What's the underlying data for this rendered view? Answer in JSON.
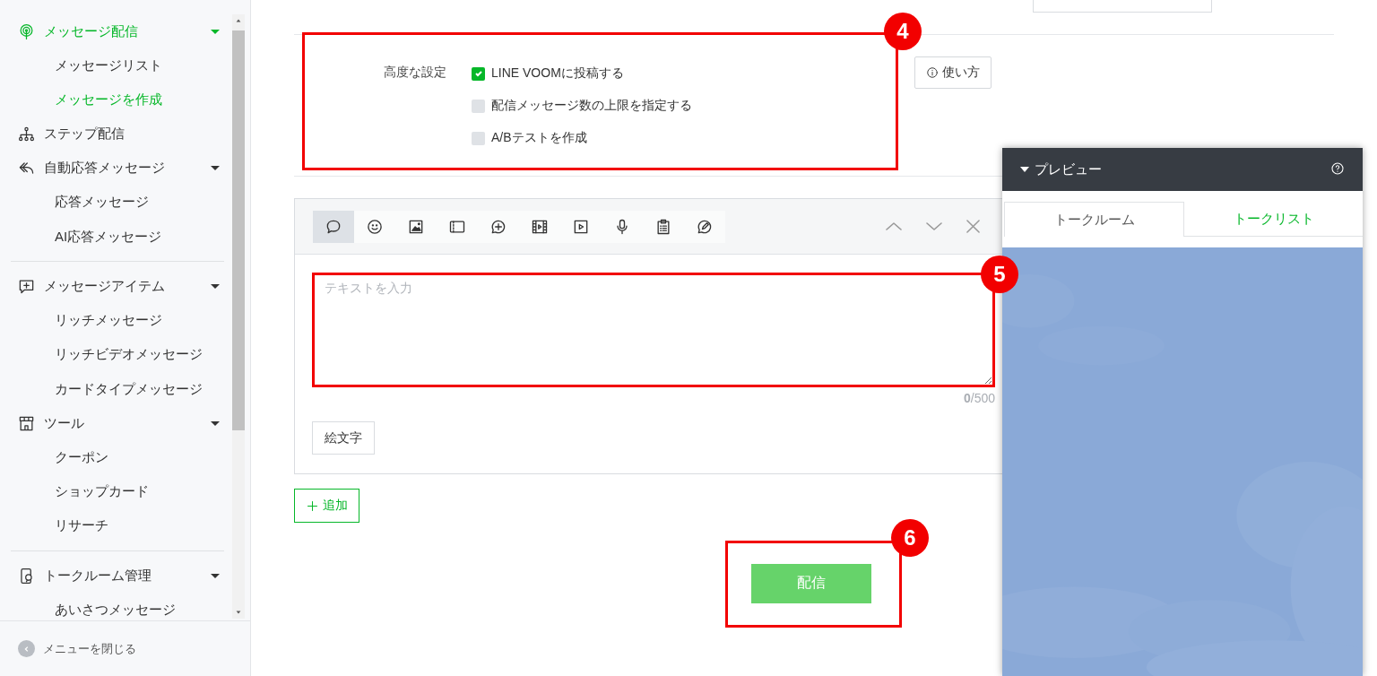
{
  "sidebar": {
    "sections": [
      {
        "items": [
          {
            "label": "メッセージ配信",
            "selected": true,
            "expanded": true,
            "children": [
              {
                "label": "メッセージリスト",
                "selected": false
              },
              {
                "label": "メッセージを作成",
                "selected": true
              }
            ]
          },
          {
            "label": "ステップ配信",
            "selected": false
          },
          {
            "label": "自動応答メッセージ",
            "selected": false,
            "expanded": true,
            "children": [
              {
                "label": "応答メッセージ",
                "selected": false
              },
              {
                "label": "AI応答メッセージ",
                "selected": false
              }
            ]
          }
        ]
      },
      {
        "items": [
          {
            "label": "メッセージアイテム",
            "selected": false,
            "expanded": true,
            "children": [
              {
                "label": "リッチメッセージ",
                "selected": false
              },
              {
                "label": "リッチビデオメッセージ",
                "selected": false
              },
              {
                "label": "カードタイプメッセージ",
                "selected": false
              }
            ]
          },
          {
            "label": "ツール",
            "selected": false,
            "expanded": true,
            "children": [
              {
                "label": "クーポン",
                "selected": false
              },
              {
                "label": "ショップカード",
                "selected": false
              },
              {
                "label": "リサーチ",
                "selected": false
              }
            ]
          }
        ]
      },
      {
        "items": [
          {
            "label": "トークルーム管理",
            "selected": false,
            "expanded": true,
            "children": [
              {
                "label": "あいさつメッセージ",
                "selected": false
              }
            ]
          }
        ]
      }
    ],
    "close_label": "メニューを閉じる"
  },
  "settings": {
    "label": "高度な設定",
    "annotation": "4",
    "options": [
      {
        "label": "LINE VOOMに投稿する",
        "checked": true
      },
      {
        "label": "配信メッセージ数の上限を指定する",
        "checked": false
      },
      {
        "label": "A/Bテストを作成",
        "checked": false
      }
    ],
    "help_button": "使い方"
  },
  "editor": {
    "tools": [
      {
        "selected": true
      },
      {
        "selected": false
      },
      {
        "selected": false
      },
      {
        "selected": false
      },
      {
        "selected": false
      },
      {
        "selected": false
      },
      {
        "selected": false
      },
      {
        "selected": false
      },
      {
        "selected": false
      },
      {
        "selected": false
      }
    ],
    "placeholder": "テキストを入力",
    "annotation": "5",
    "counter": "**0**/500",
    "emoji_button": "絵文字"
  },
  "add_button": "追加",
  "send": {
    "label": "配信",
    "annotation": "6"
  },
  "preview": {
    "title": "プレビュー",
    "tabs": [
      {
        "label": "トークルーム",
        "selected": true
      },
      {
        "label": "トークリスト",
        "selected": false
      }
    ]
  }
}
